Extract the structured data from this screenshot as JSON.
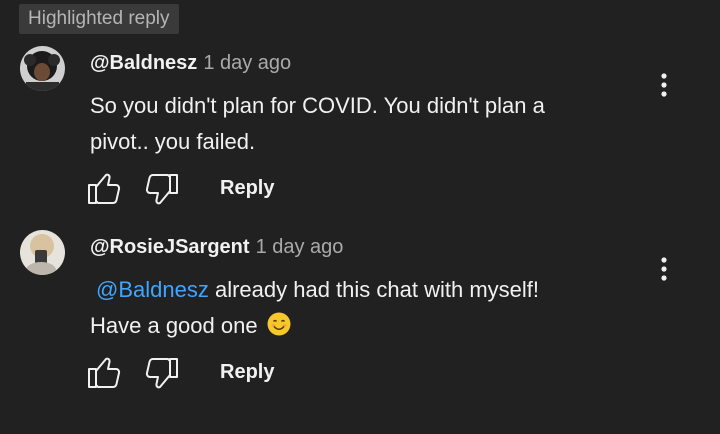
{
  "badge": "Highlighted reply",
  "comments": [
    {
      "author": "@Baldnesz",
      "time": "1 day ago",
      "lines": [
        "So you didn't plan for COVID.  You didn't plan a",
        "pivot.. you failed."
      ],
      "reply_label": "Reply"
    },
    {
      "author": "@RosieJSargent",
      "time": "1 day ago",
      "mention": "@Baldnesz",
      "line1_rest": " already had this chat with myself!",
      "line2": "Have a good one",
      "reply_label": "Reply"
    }
  ],
  "icons": {
    "like": "thumbs-up-icon",
    "dislike": "thumbs-down-icon",
    "menu": "more-vertical-icon",
    "emoji": "smiling-face-emoji"
  },
  "colors": {
    "background": "#212121",
    "mention": "#3ea6ff",
    "secondary_text": "#aaaaaa"
  }
}
